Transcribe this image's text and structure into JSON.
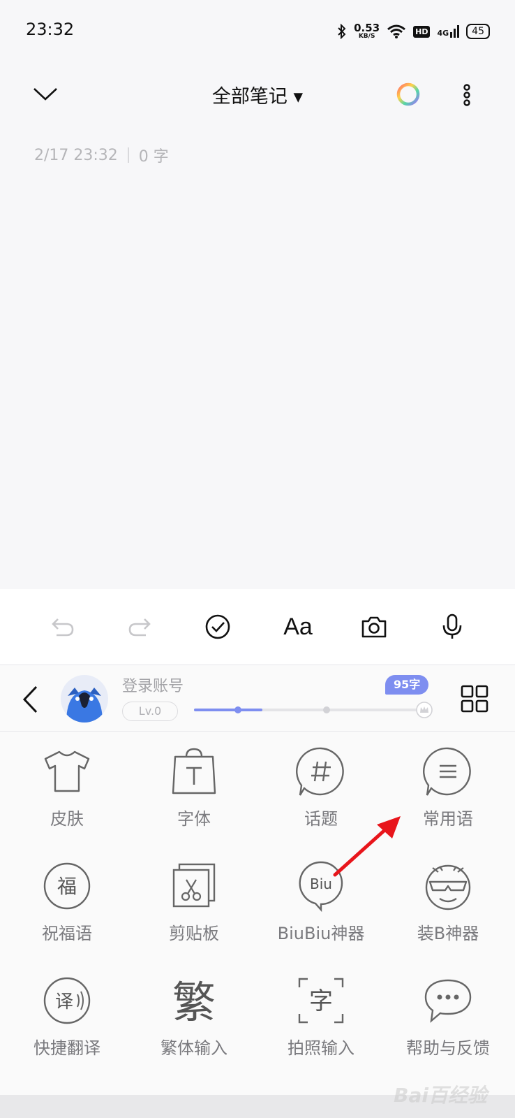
{
  "status": {
    "time": "23:32",
    "speed_value": "0.53",
    "speed_unit": "KB/S",
    "hd": "HD",
    "network": "4G",
    "battery": "45"
  },
  "header": {
    "title": "全部笔记 ▾"
  },
  "note": {
    "date": "2/17 23:32",
    "count": "0 字"
  },
  "toolbar": {
    "font_label": "Aa"
  },
  "keyboard": {
    "login": "登录账号",
    "level": "Lv.0",
    "badge": "95字",
    "progress": 0.3,
    "items": [
      {
        "label": "皮肤",
        "icon": "shirt-icon"
      },
      {
        "label": "字体",
        "icon": "font-bag-icon"
      },
      {
        "label": "话题",
        "icon": "hashtag-icon"
      },
      {
        "label": "常用语",
        "icon": "phrases-icon"
      },
      {
        "label": "祝福语",
        "icon": "blessing-icon",
        "glyph": "福"
      },
      {
        "label": "剪贴板",
        "icon": "clipboard-icon"
      },
      {
        "label": "BiuBiu神器",
        "icon": "biu-icon",
        "glyph": "Biu"
      },
      {
        "label": "装B神器",
        "icon": "face-icon"
      },
      {
        "label": "快捷翻译",
        "icon": "translate-icon",
        "glyph": "译"
      },
      {
        "label": "繁体输入",
        "icon": "traditional-icon",
        "glyph": "繁"
      },
      {
        "label": "拍照输入",
        "icon": "photo-input-icon",
        "glyph": "字"
      },
      {
        "label": "帮助与反馈",
        "icon": "help-feedback-icon"
      }
    ]
  },
  "watermark": "Bai百经验"
}
